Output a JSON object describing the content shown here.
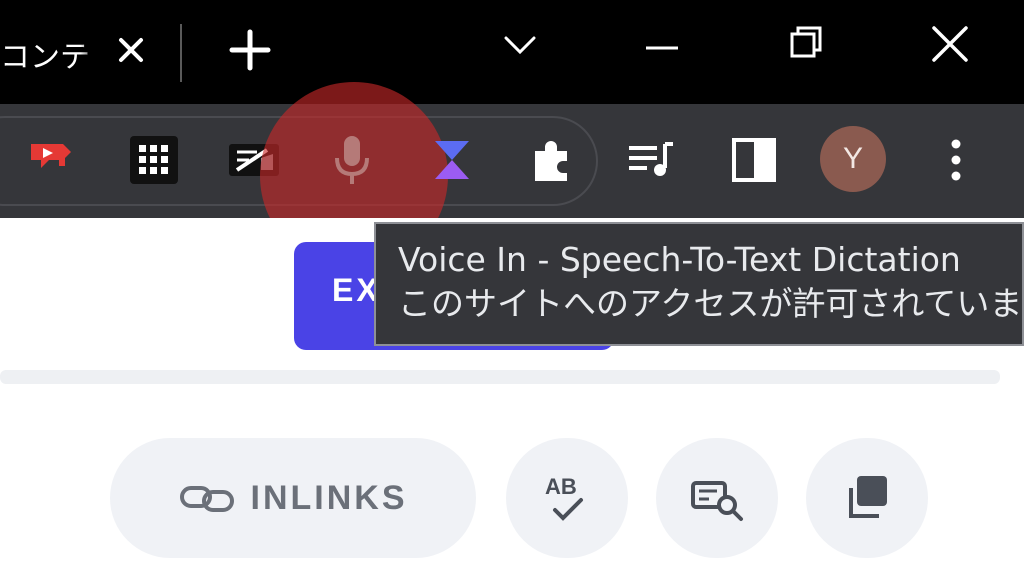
{
  "browser": {
    "tab": {
      "title": "コンテ",
      "close_label": "×"
    },
    "new_tab_label": "+"
  },
  "toolbar": {
    "extensions": [
      {
        "name": "youtube-red-extension",
        "color": "#e53935"
      },
      {
        "name": "grid-apps-extension",
        "color": "#ffffff"
      },
      {
        "name": "screenshot-extension",
        "color": "#ffffff"
      },
      {
        "name": "voice-in-microphone-extension",
        "color": "#b0706f"
      },
      {
        "name": "hourglass-extension",
        "color": "#7c5cf2"
      },
      {
        "name": "extensions-puzzle",
        "color": "#ffffff"
      }
    ],
    "profile_initial": "Y",
    "profile_color": "#8a5a4f"
  },
  "tooltip": {
    "line1": "Voice In - Speech-To-Text Dictation",
    "line2": "このサイトへのアクセスが許可されています"
  },
  "page": {
    "export_button_label": "EX",
    "inlinks_label": "INLINKS",
    "ab_label": "AB",
    "accent_color": "#4a43e6"
  }
}
